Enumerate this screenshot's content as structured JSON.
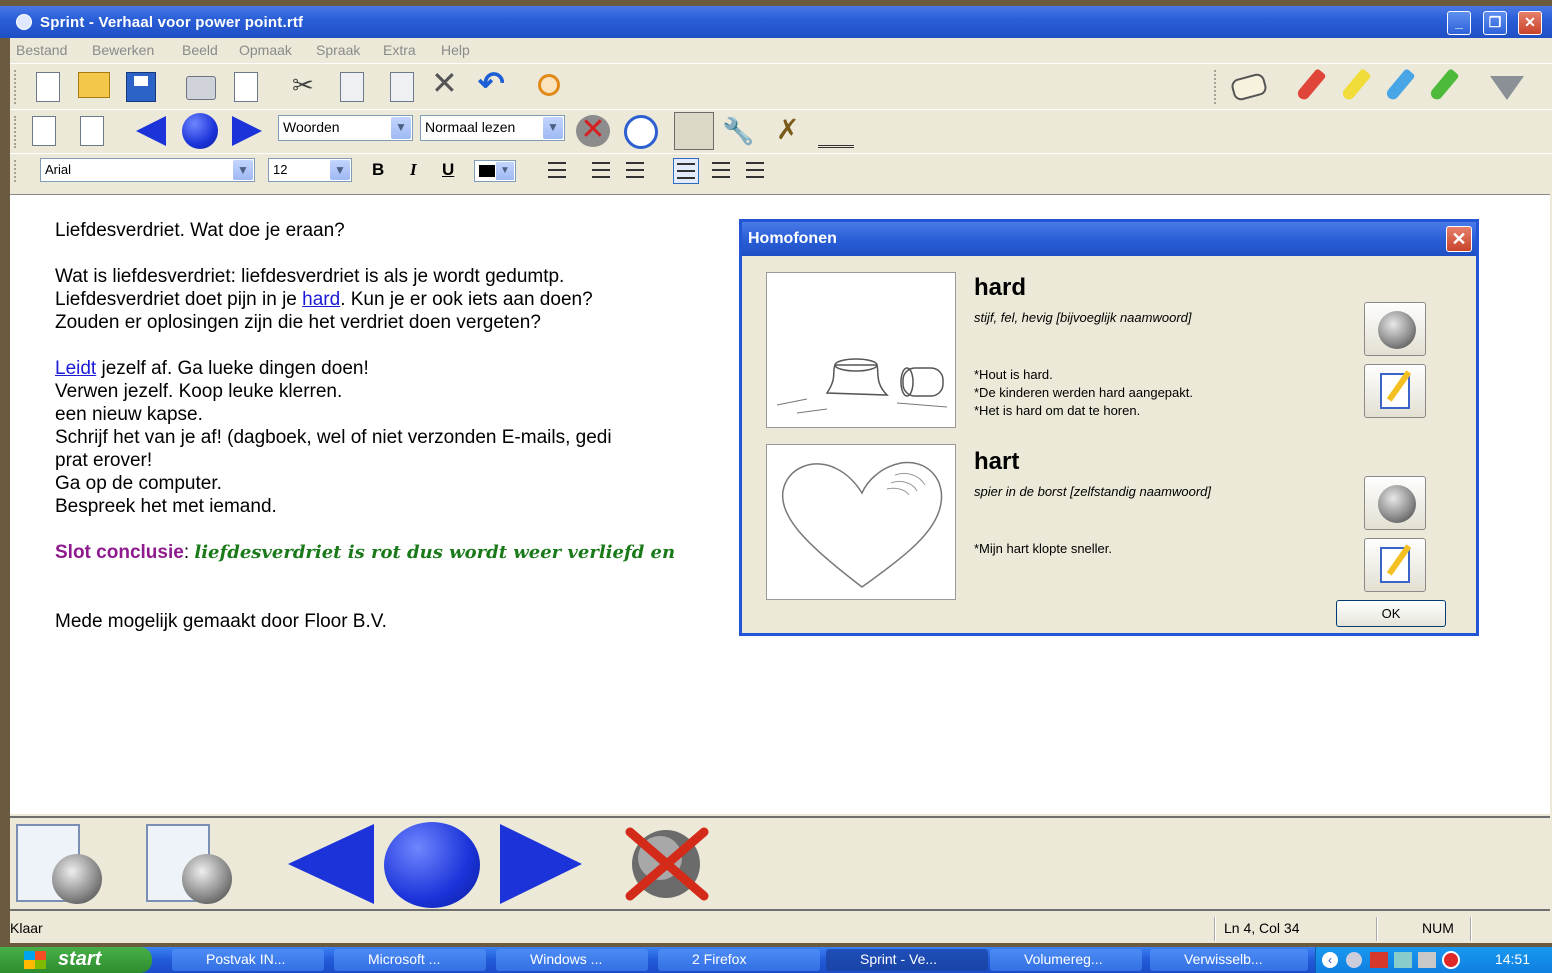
{
  "window": {
    "title": "Sprint - Verhaal voor power point.rtf"
  },
  "menu": [
    "Bestand",
    "Bewerken",
    "Beeld",
    "Opmaak",
    "Spraak",
    "Extra",
    "Help"
  ],
  "toolbar2": {
    "reading_unit": "Woorden",
    "reading_mode": "Normaal lezen"
  },
  "toolbar3": {
    "font": "Arial",
    "size": "12",
    "bold": "B",
    "italic": "I",
    "underline": "U"
  },
  "document": {
    "lines": {
      "l1": "Liefdesverdriet. Wat doe je eraan?",
      "l2": "Wat is liefdesverdriet: liefdesverdriet is als je wordt gedumtp.",
      "l3a": "Liefdesverdriet doet pijn in je ",
      "l3link": "hard",
      "l3b": ". Kun je er ook iets aan doen?",
      "l4": "Zouden er oplosingen zijn die het verdriet doen vergeten?",
      "l5link": "Leidt",
      "l5b": " jezelf af. Ga lueke dingen doen!",
      "l6": "Verwen jezelf. Koop leuke klerren.",
      "l7": "een nieuw kapse.",
      "l8": "Schrijf het van je af! (dagboek, wel of niet verzonden E-mails, gedi",
      "l9": "prat erover!",
      "l10": "Ga op de computer.",
      "l11": "Bespreek het met iemand.",
      "slot_label": "Slot conclusie",
      "slot_colon": ": ",
      "slot_text": "liefdesverdriet is rot dus wordt weer verliefd en",
      "credit": "Mede mogelijk gemaakt door Floor B.V."
    }
  },
  "dialog": {
    "title": "Homofonen",
    "entries": [
      {
        "word": "hard",
        "definition": "stijf, fel, hevig [bijvoeglijk naamwoord]",
        "examples": [
          "*Hout is hard.",
          "*De kinderen werden hard aangepakt.",
          "*Het is hard om dat te horen."
        ]
      },
      {
        "word": "hart",
        "definition": "spier in de borst [zelfstandig naamwoord]",
        "examples": [
          "*Mijn hart klopte sneller."
        ]
      }
    ],
    "ok_label": "OK"
  },
  "statusbar": {
    "status": "Klaar",
    "position": "Ln 4, Col 34",
    "num": "NUM"
  },
  "taskbar": {
    "start_label": "start",
    "tasks": [
      "Postvak IN...",
      "Microsoft ...",
      "Windows ...",
      "2 Firefox",
      "Sprint - Ve...",
      "Volumereg...",
      "Verwisselb..."
    ],
    "clock": "14:51"
  },
  "colors": {
    "titlebar_blue": "#2a5fd8",
    "link_blue": "#1a1ad8",
    "slot_purple": "#8e1a8e",
    "slot_green": "#1a7a1a",
    "nav_blue": "#1b33d9"
  }
}
